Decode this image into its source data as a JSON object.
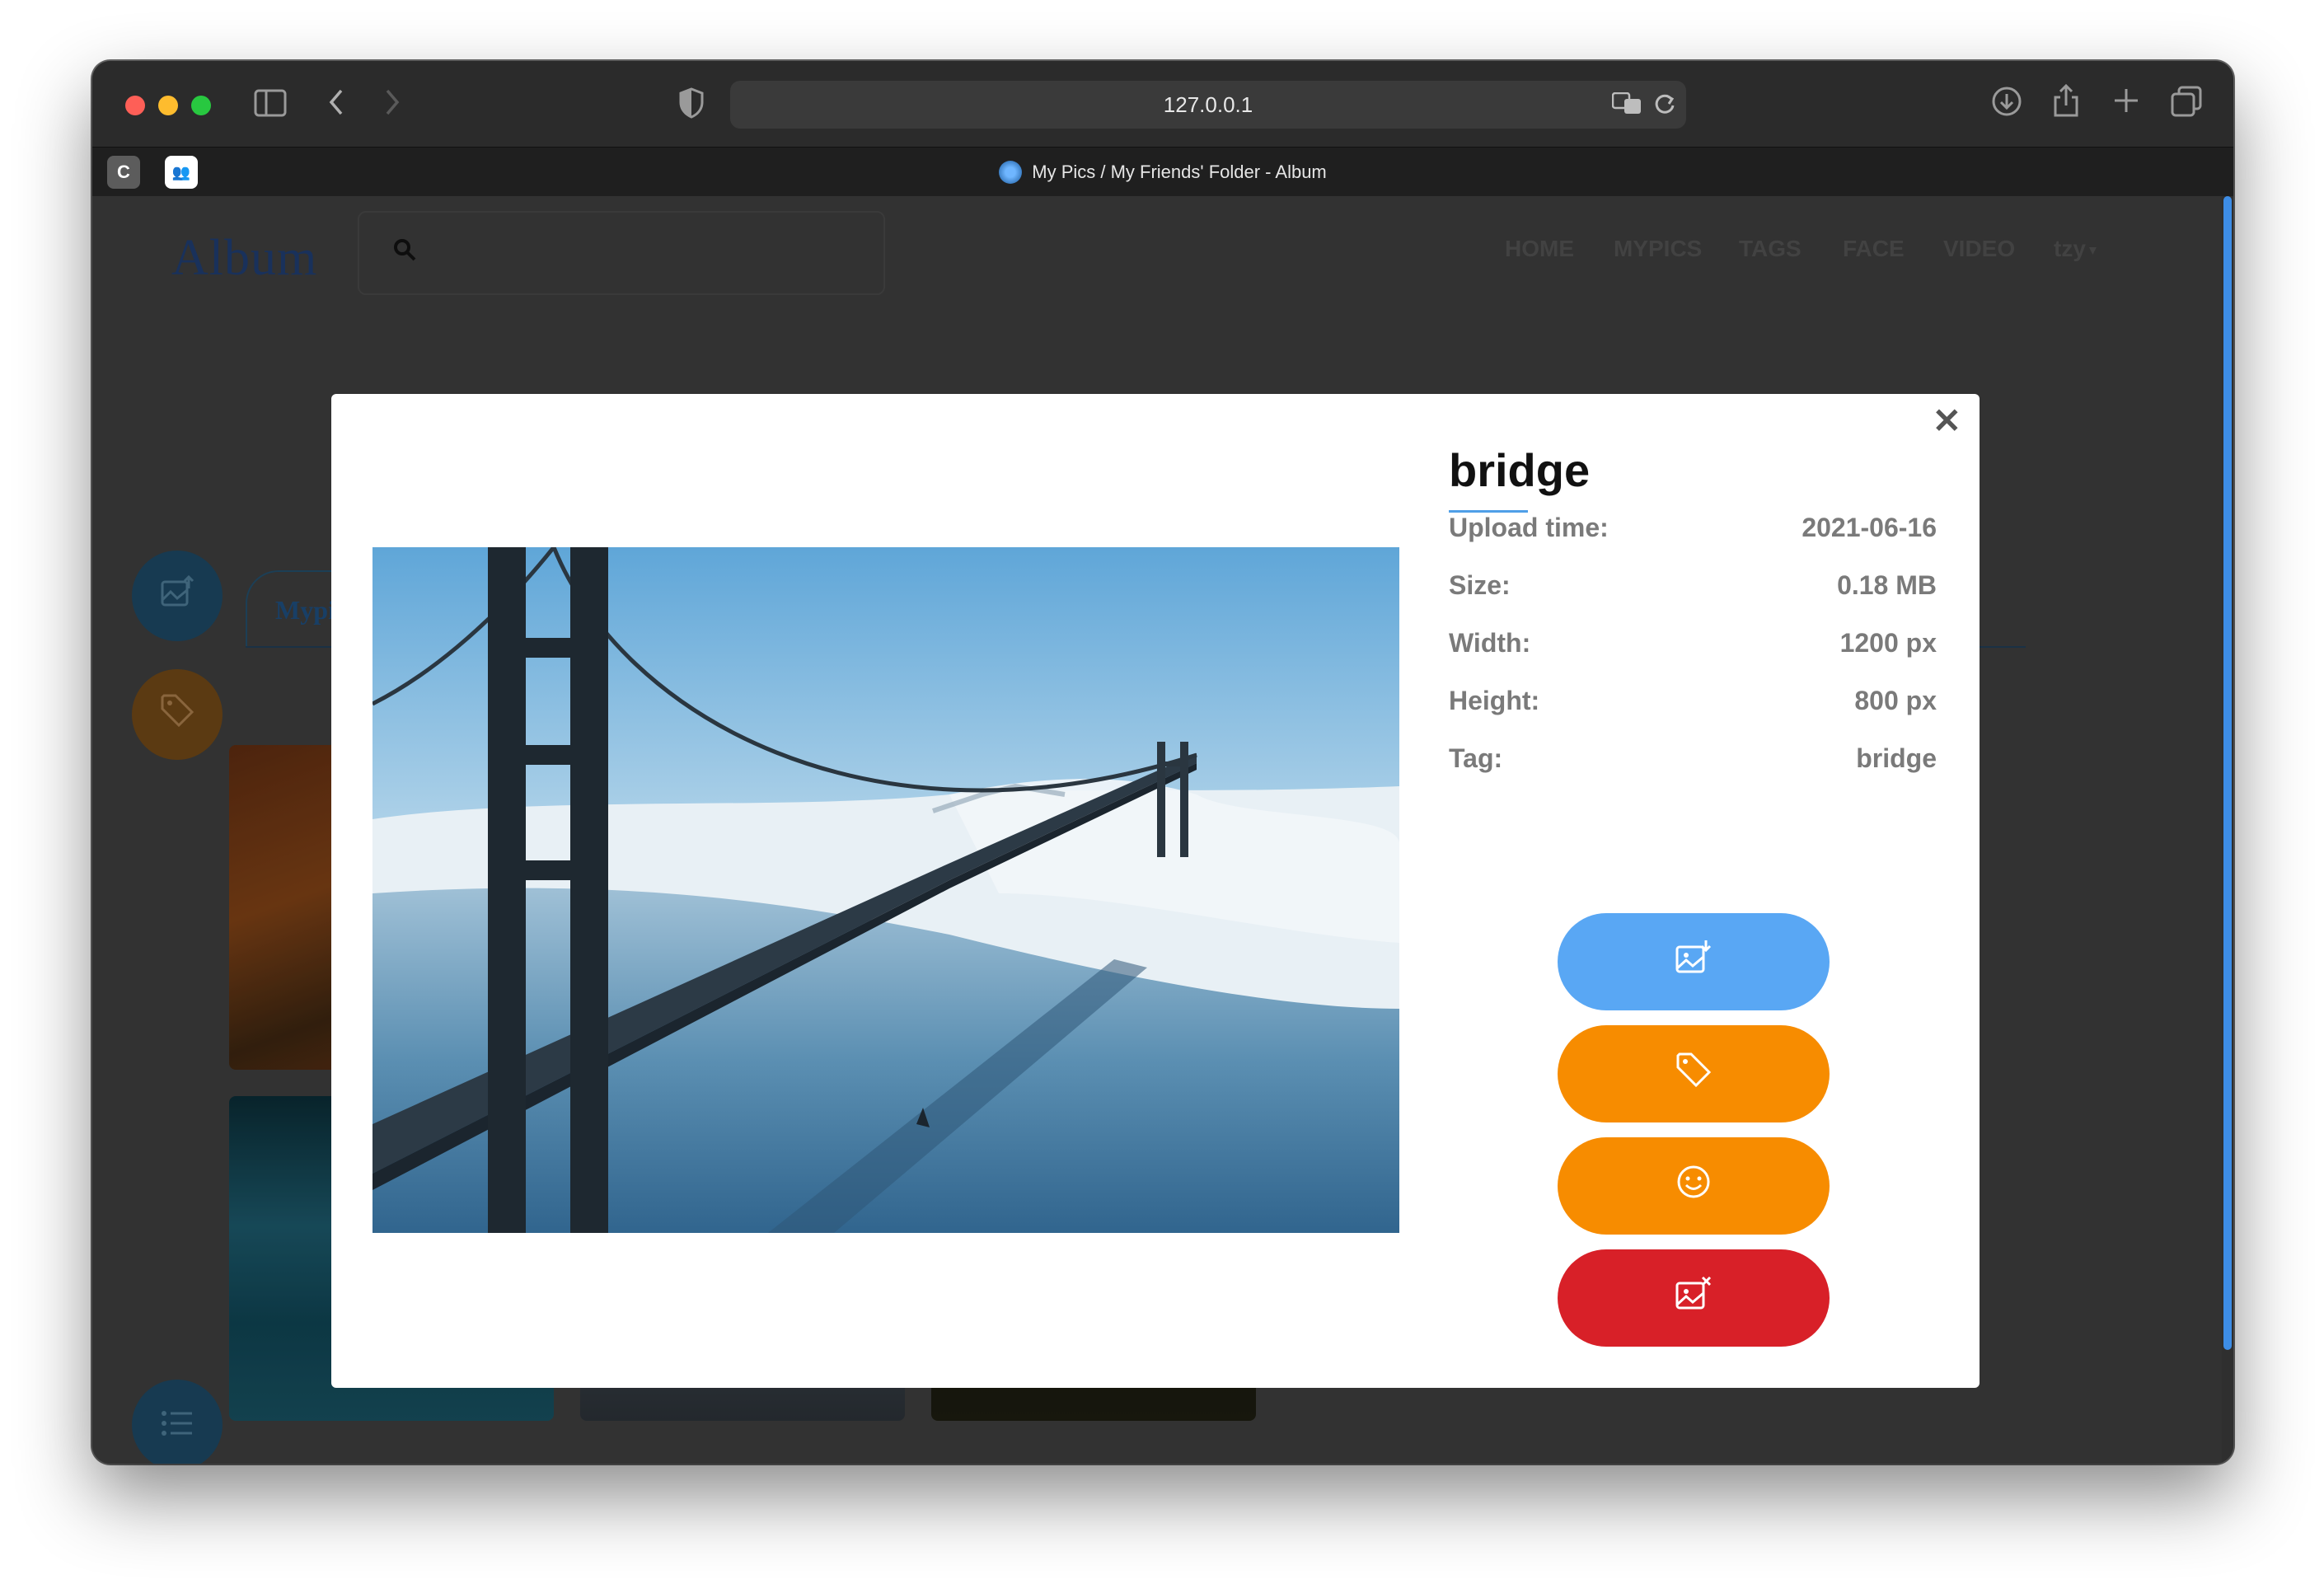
{
  "browser": {
    "url": "127.0.0.1",
    "tab_title": "My Pics / My Friends' Folder - Album",
    "pinned_tabs": [
      "C",
      "👥"
    ]
  },
  "site": {
    "logo": "Album",
    "nav": [
      "HOME",
      "MYPICS",
      "TAGS",
      "FACE",
      "VIDEO",
      "tzy"
    ],
    "section_tab": "Mypi"
  },
  "modal": {
    "title": "bridge",
    "fields": [
      {
        "label": "Upload time:",
        "value": "2021-06-16"
      },
      {
        "label": "Size:",
        "value": "0.18 MB"
      },
      {
        "label": "Width:",
        "value": "1200 px"
      },
      {
        "label": "Height:",
        "value": "800 px"
      },
      {
        "label": "Tag:",
        "value": "bridge"
      }
    ],
    "actions": [
      {
        "name": "download-image",
        "icon": "image-download-icon",
        "color": "#59a7f4"
      },
      {
        "name": "edit-tag",
        "icon": "tag-icon",
        "color": "#f78c00"
      },
      {
        "name": "face",
        "icon": "smile-icon",
        "color": "#f78c00"
      },
      {
        "name": "delete-image",
        "icon": "image-delete-icon",
        "color": "#d82028"
      }
    ]
  }
}
